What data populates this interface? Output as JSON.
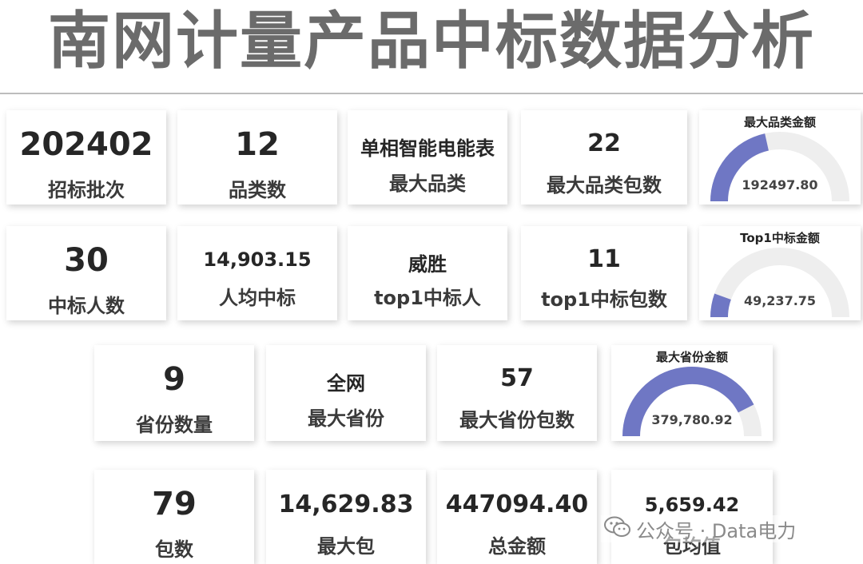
{
  "title": "南网计量产品中标数据分析",
  "row1": [
    {
      "value": "202402",
      "label": "招标批次"
    },
    {
      "value": "12",
      "label": "品类数"
    },
    {
      "value": "单相智能电能表",
      "label": "最大品类"
    },
    {
      "value": "22",
      "label": "最大品类包数"
    }
  ],
  "row2": [
    {
      "value": "30",
      "label": "中标人数"
    },
    {
      "value": "14,903.15",
      "label": "人均中标"
    },
    {
      "value": "威胜",
      "label": "top1中标人"
    },
    {
      "value": "11",
      "label": "top1中标包数"
    }
  ],
  "row3": [
    {
      "value": "9",
      "label": "省份数量"
    },
    {
      "value": "全网",
      "label": "最大省份"
    },
    {
      "value": "57",
      "label": "最大省份包数"
    }
  ],
  "row4": [
    {
      "value": "79",
      "label": "包数"
    },
    {
      "value": "14,629.83",
      "label": "最大包"
    },
    {
      "value": "447094.40",
      "label": "总金额"
    },
    {
      "value": "5,659.42",
      "label": "包均值"
    }
  ],
  "gauges": [
    {
      "title": "最大品类金额",
      "value": "192497.80",
      "fraction": 0.4305
    },
    {
      "title": "Top1中标金额",
      "value": "49,237.75",
      "fraction": 0.1101
    },
    {
      "title": "最大省份金额",
      "value": "379,780.92",
      "fraction": 0.8494
    }
  ],
  "colors": {
    "gauge_fill": "#6f77c4",
    "gauge_track": "#eeeeee",
    "title": "#6b6b6b"
  },
  "watermark": {
    "icon": "wechat-icon",
    "text": "公众号 · Data电力"
  }
}
